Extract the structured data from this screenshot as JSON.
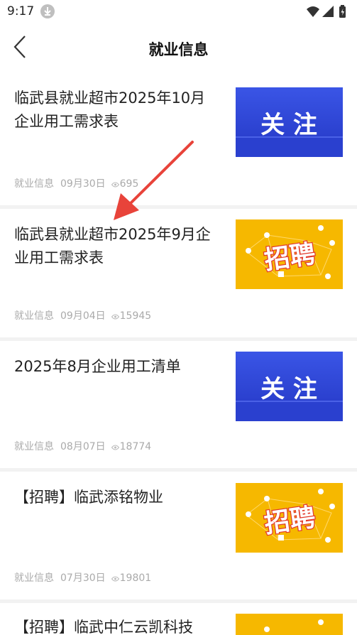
{
  "status": {
    "time": "9:17",
    "icons": [
      "download-icon",
      "wifi-icon",
      "cellular-signal-icon",
      "battery-charging-icon"
    ]
  },
  "nav": {
    "title": "就业信息",
    "back_icon": "chevron-left-icon"
  },
  "thumb_text": {
    "follow": "关 注",
    "recruit": "招聘"
  },
  "colors": {
    "follow_blue": "#2f49d8",
    "recruit_yellow": "#f6b800",
    "arrow_red": "#e8433a"
  },
  "articles": [
    {
      "title": "临武县就业超市2025年10月企业用工需求表",
      "category": "就业信息",
      "date": "09月30日",
      "views": "695",
      "thumb": "follow"
    },
    {
      "title": "临武县就业超市2025年9月企业用工需求表",
      "category": "就业信息",
      "date": "09月04日",
      "views": "15945",
      "thumb": "recruit"
    },
    {
      "title": "2025年8月企业用工清单",
      "category": "就业信息",
      "date": "08月07日",
      "views": "18774",
      "thumb": "follow"
    },
    {
      "title": "【招聘】临武添铭物业",
      "category": "就业信息",
      "date": "07月30日",
      "views": "19801",
      "thumb": "recruit"
    },
    {
      "title": "【招聘】临武中仁云凯科技",
      "category": "",
      "date": "",
      "views": "",
      "thumb": "recruit"
    }
  ]
}
